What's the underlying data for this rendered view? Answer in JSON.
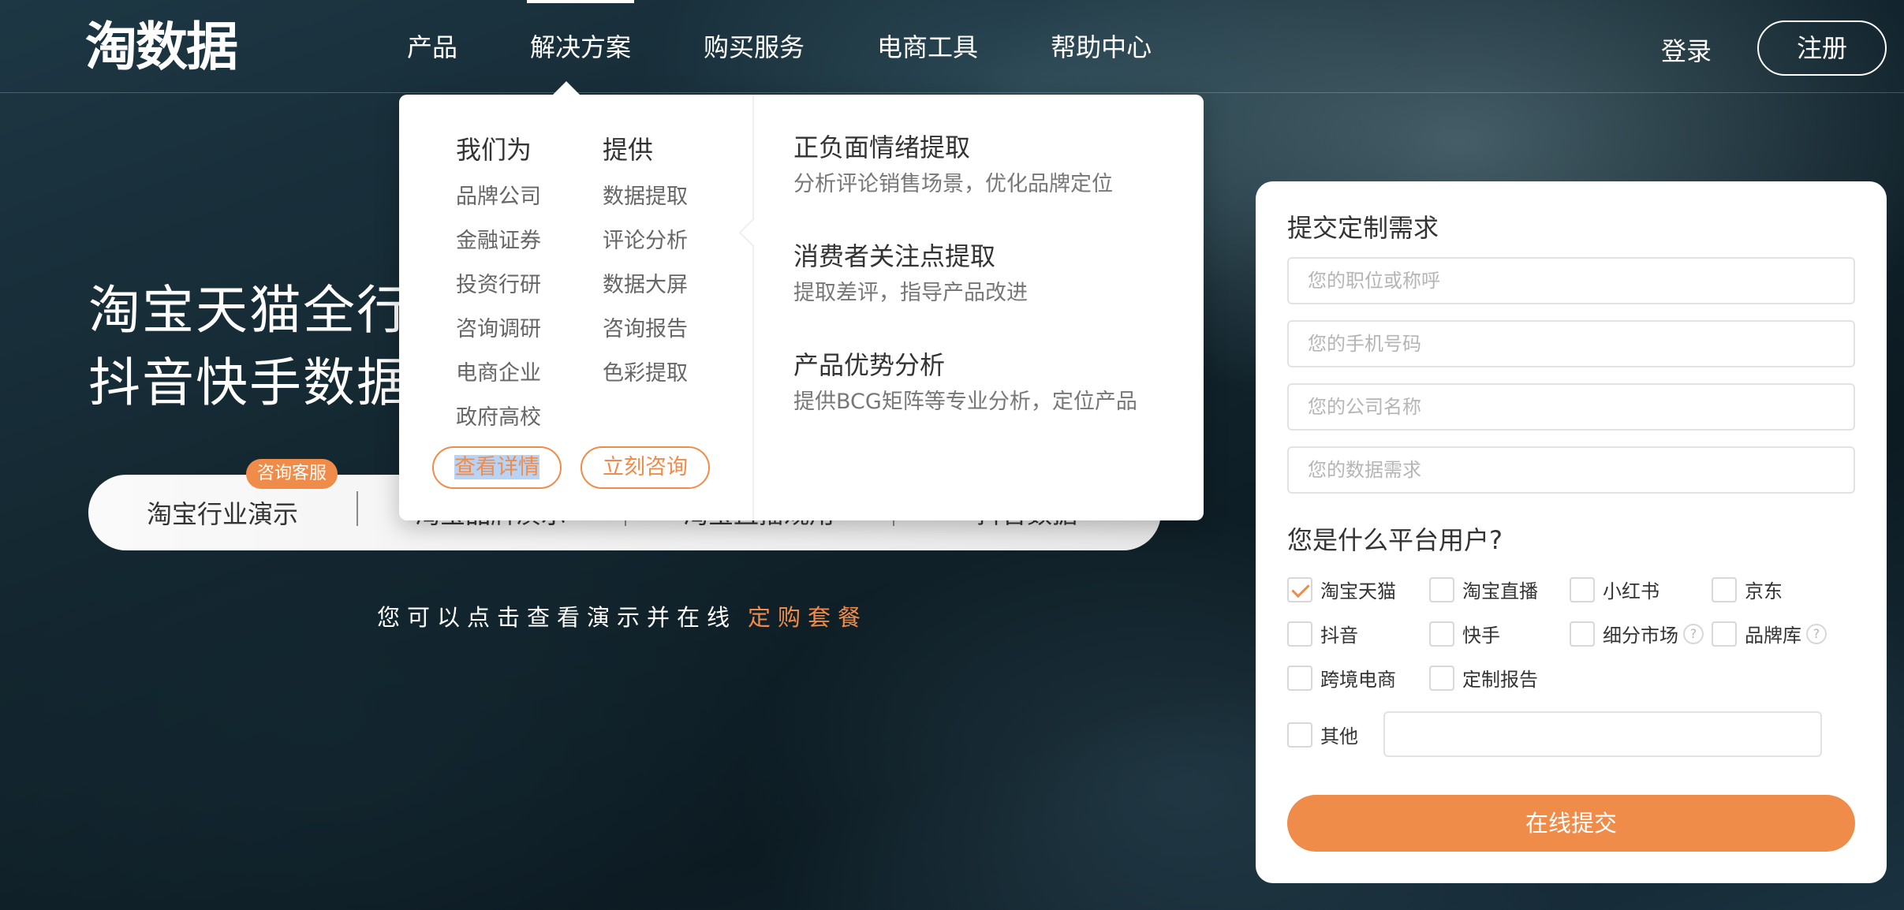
{
  "header": {
    "logo": "淘数据",
    "nav": [
      "产品",
      "解决方案",
      "购买服务",
      "电商工具",
      "帮助中心"
    ],
    "login": "登录",
    "register": "注册"
  },
  "hero": {
    "title_line1": "淘宝天猫全行业",
    "title_line2": "抖音快手数据，",
    "badge": "咨询客服",
    "demo_tabs": [
      "淘宝行业演示",
      "淘宝品牌演示",
      "淘宝直播观用",
      "抖音数据"
    ],
    "subtitle": "您可以点击查看演示并在线",
    "subtitle_link": "定购套餐"
  },
  "dropdown": {
    "col1_head": "我们为",
    "col1_items": [
      "品牌公司",
      "金融证券",
      "投资行研",
      "咨询调研",
      "电商企业",
      "政府高校"
    ],
    "col2_head": "提供",
    "col2_items": [
      "数据提取",
      "评论分析",
      "数据大屏",
      "咨询报告",
      "色彩提取"
    ],
    "details_btn": "查看详情",
    "consult_btn": "立刻咨询",
    "features": [
      {
        "title": "正负面情绪提取",
        "desc": "分析评论销售场景，优化品牌定位"
      },
      {
        "title": "消费者关注点提取",
        "desc": "提取差评，指导产品改进"
      },
      {
        "title": "产品优势分析",
        "desc": "提供BCG矩阵等专业分析，定位产品"
      }
    ]
  },
  "form": {
    "title": "提交定制需求",
    "placeholders": [
      "您的职位或称呼",
      "您的手机号码",
      "您的公司名称",
      "您的数据需求"
    ],
    "platform_question": "您是什么平台用户?",
    "platforms": [
      "淘宝天猫",
      "淘宝直播",
      "小红书",
      "京东",
      "抖音",
      "快手",
      "细分市场",
      "品牌库",
      "跨境电商",
      "定制报告"
    ],
    "other_label": "其他",
    "submit": "在线提交",
    "help_symbol": "?"
  },
  "colors": {
    "accent": "#f08c4a",
    "background": "#13262f",
    "card": "#ffffff"
  }
}
